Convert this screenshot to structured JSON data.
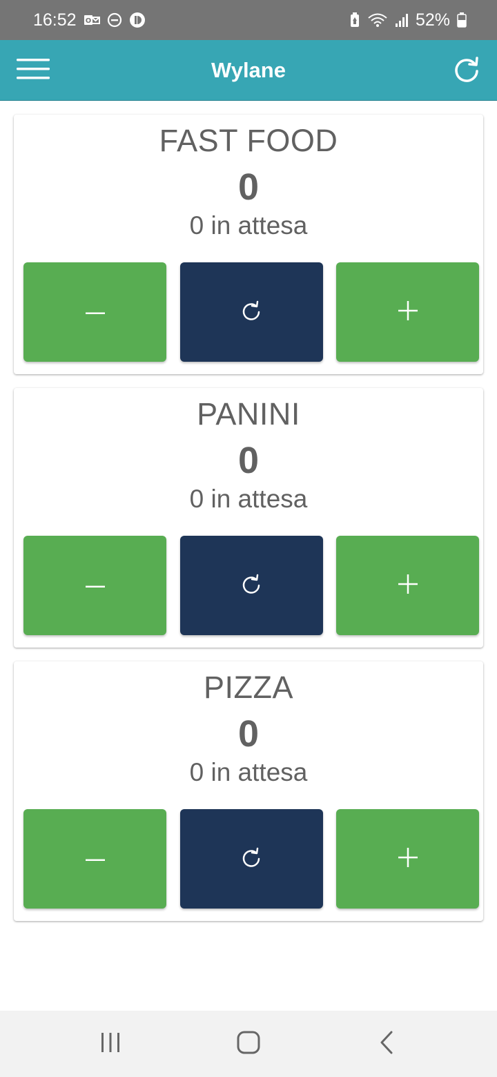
{
  "status_bar": {
    "time": "16:52",
    "battery": "52%",
    "icons": [
      "outlook-icon",
      "do-not-disturb-icon",
      "app-notification-icon",
      "battery-saver-icon",
      "wifi-icon",
      "signal-icon",
      "battery-icon"
    ]
  },
  "app_bar": {
    "title": "Wylane",
    "background": "#37a6b4",
    "icons": {
      "menu": "hamburger-menu-icon",
      "refresh": "refresh-icon"
    }
  },
  "queues": [
    {
      "name": "FAST FOOD",
      "count": "0",
      "waiting": "0 in attesa"
    },
    {
      "name": "PANINI",
      "count": "0",
      "waiting": "0 in attesa"
    },
    {
      "name": "PIZZA",
      "count": "0",
      "waiting": "0 in attesa"
    }
  ],
  "buttons": {
    "decrement_icon": "minus-icon",
    "reset_icon": "reset-icon",
    "increment_icon": "plus-icon",
    "green": "#58ad52",
    "navy": "#1e3557"
  },
  "nav_bar": {
    "icons": [
      "recent-apps-icon",
      "home-icon",
      "back-icon"
    ]
  }
}
